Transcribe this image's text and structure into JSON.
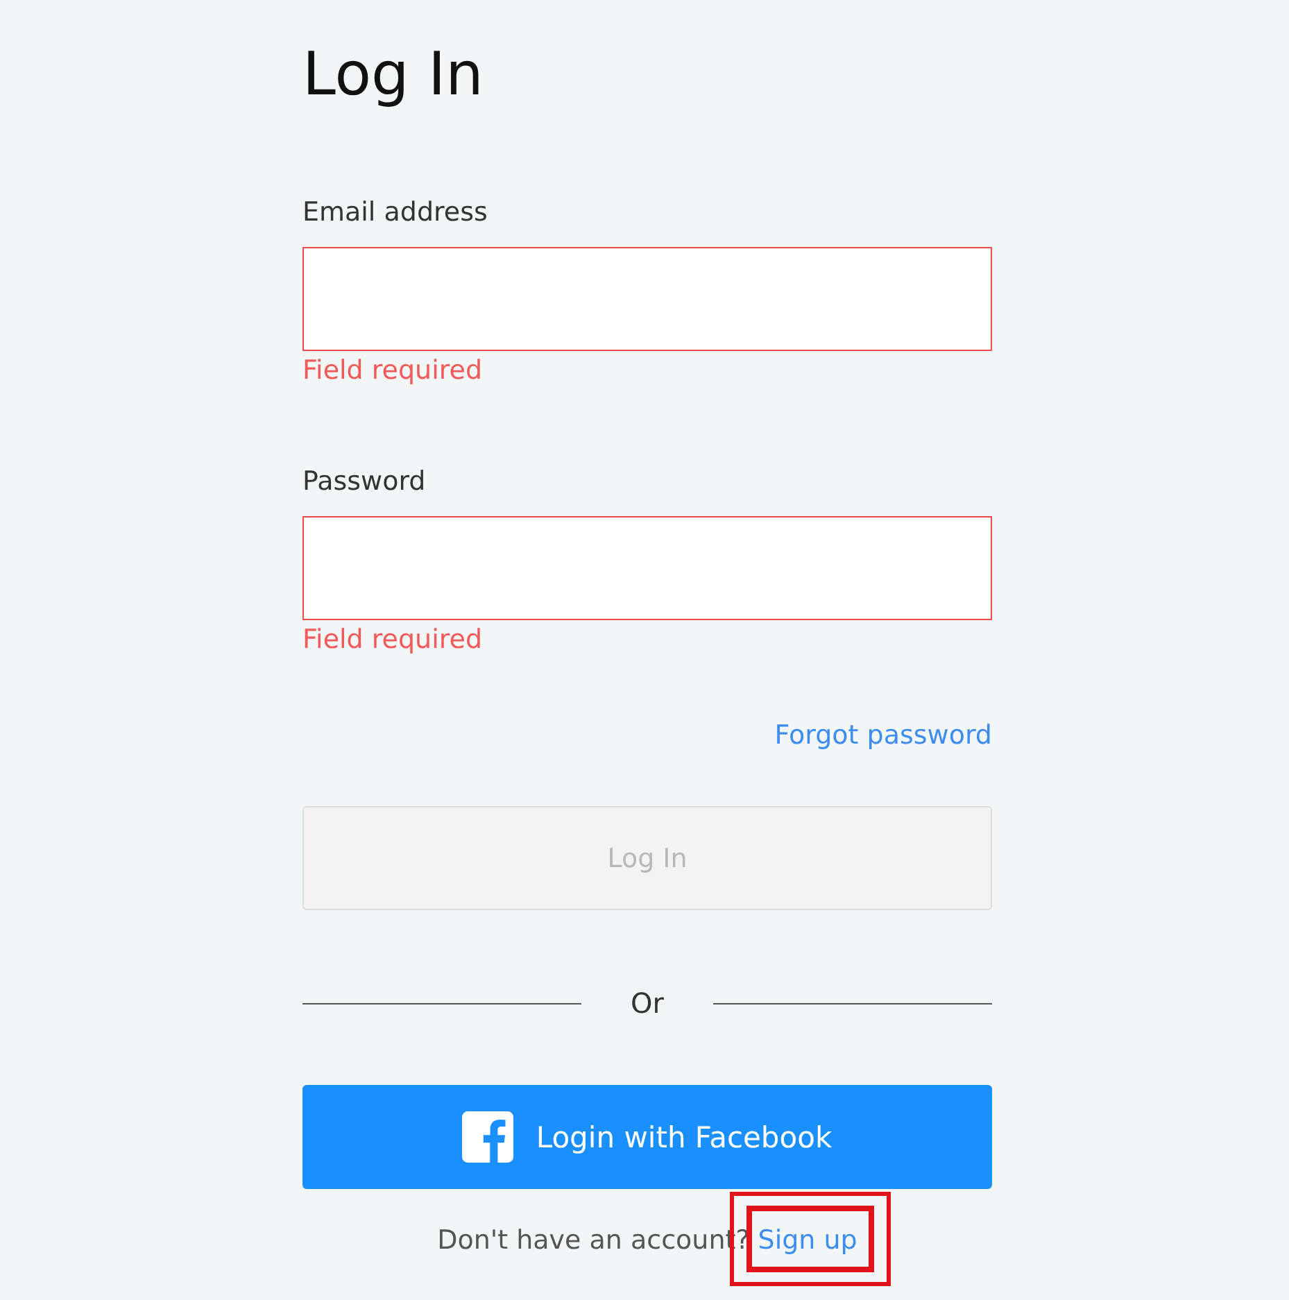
{
  "title": "Log In",
  "fields": [
    {
      "label": "Email address",
      "invalid": true,
      "error": "Field required"
    },
    {
      "label": "Password",
      "invalid": true,
      "error": "Field required"
    }
  ],
  "forgot_link": "Forgot password",
  "login_button": {
    "label": "Log In",
    "disabled": true
  },
  "divider_text": "Or",
  "facebook_button": {
    "label": "Login with Facebook"
  },
  "footer": {
    "text": "Don't have an account?",
    "link": "Sign up",
    "highlighted": true
  }
}
